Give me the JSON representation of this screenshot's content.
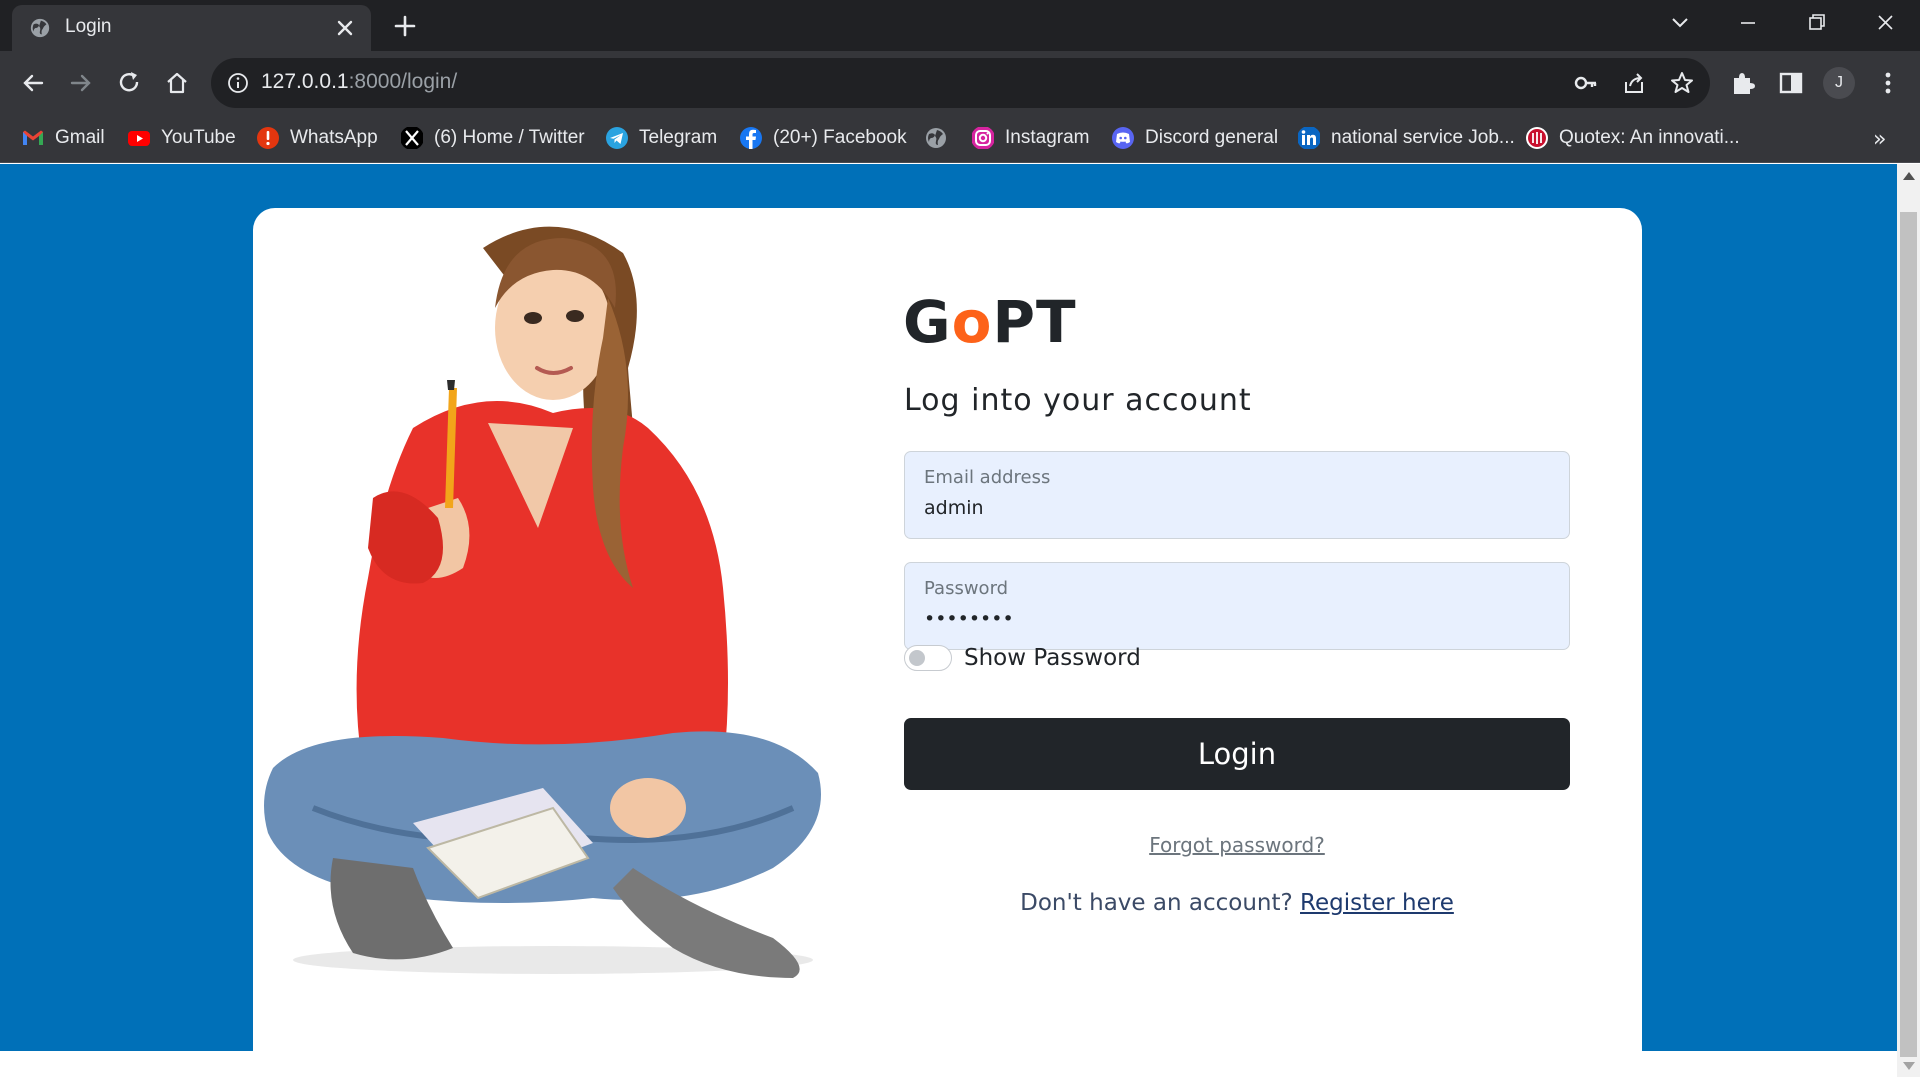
{
  "browser": {
    "tab_title": "Login",
    "url_host": "127.0.0.1",
    "url_path": ":8000/login/",
    "profile_initial": "J",
    "bookmarks": [
      {
        "label": "Gmail",
        "icon": "gmail-icon"
      },
      {
        "label": "YouTube",
        "icon": "youtube-icon"
      },
      {
        "label": "WhatsApp",
        "icon": "whatsapp-icon"
      },
      {
        "label": "(6) Home / Twitter",
        "icon": "x-twitter-icon"
      },
      {
        "label": "Telegram",
        "icon": "telegram-icon"
      },
      {
        "label": "(20+) Facebook",
        "icon": "facebook-icon"
      },
      {
        "label": "",
        "icon": "globe-icon"
      },
      {
        "label": "Instagram",
        "icon": "instagram-icon"
      },
      {
        "label": "Discord general",
        "icon": "discord-icon"
      },
      {
        "label": "national service Job...",
        "icon": "linkedin-icon"
      },
      {
        "label": "Quotex: An innovati...",
        "icon": "quotex-icon"
      }
    ],
    "bookmarks_overflow": "»"
  },
  "login": {
    "brand_prefix": "G",
    "brand_accent": "o",
    "brand_suffix": "PT",
    "subtitle": "Log into your account",
    "email_label": "Email address",
    "email_value": "admin",
    "password_label": "Password",
    "password_value": "••••••••",
    "show_password_label": "Show Password",
    "login_button": "Login",
    "forgot_password": "Forgot password?",
    "register_prompt": "Don't have an account? ",
    "register_link": "Register here"
  },
  "colors": {
    "page_background": "#0070b8",
    "brand_accent": "#fd6219",
    "button": "#212529",
    "input_background": "#e8f0fe",
    "hero_sweater": "#e8322a",
    "hero_jeans": "#6b8fb8"
  }
}
